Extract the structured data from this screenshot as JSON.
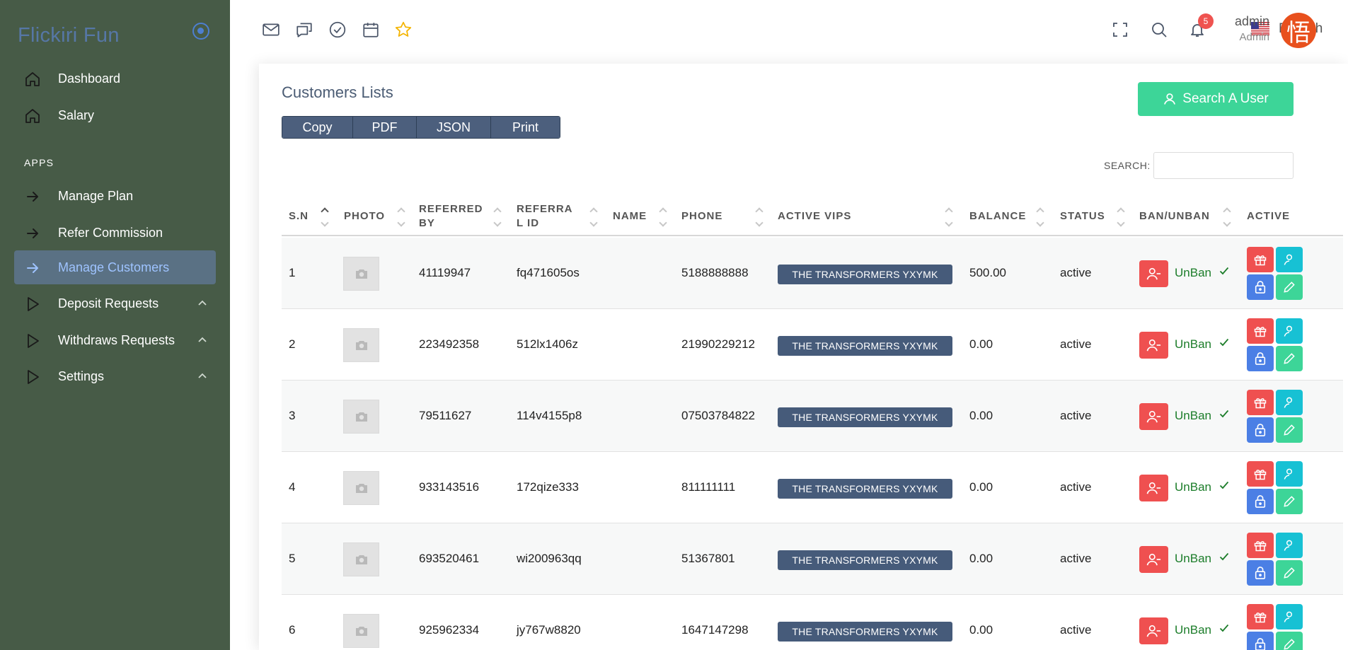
{
  "app": {
    "brand": "Flickiri Fun"
  },
  "sidebar": {
    "items": [
      {
        "label": "Dashboard",
        "icon": "home-icon"
      },
      {
        "label": "Salary",
        "icon": "home-icon"
      }
    ],
    "section_label": "APPS",
    "apps": [
      {
        "label": "Manage Plan",
        "icon": "arrow-right-icon"
      },
      {
        "label": "Refer Commission",
        "icon": "arrow-right-icon"
      },
      {
        "label": "Manage Customers",
        "icon": "arrow-right-icon",
        "active": true
      },
      {
        "label": "Deposit Requests",
        "icon": "play-triangle-icon"
      },
      {
        "label": "Withdraws Requests",
        "icon": "play-triangle-icon"
      },
      {
        "label": "Settings",
        "icon": "play-triangle-icon"
      }
    ]
  },
  "topbar": {
    "language": "English",
    "notifications_count": "5",
    "user_name": "admin",
    "user_role": "Admin",
    "avatar_text": "悟"
  },
  "page": {
    "title": "Customers Lists",
    "export_buttons": [
      "Copy",
      "PDF",
      "JSON",
      "Print"
    ],
    "search_user_label": "Search A User",
    "search_label": "SEARCH:",
    "search_value": ""
  },
  "table": {
    "headers": {
      "sn": "S.N",
      "photo": "PHOTO",
      "referred_by_1": "REFERRED",
      "referred_by_2": "BY",
      "referral_id_1": "REFERRA",
      "referral_id_2": "L ID",
      "name": "NAME",
      "phone": "PHONE",
      "active_vips": "ACTIVE VIPS",
      "balance": "BALANCE",
      "status": "STATUS",
      "ban_unban": "BAN/UNBAN",
      "active": "ACTIVE"
    },
    "rows": [
      {
        "sn": "1",
        "referred_by": "41119947",
        "referral_id": "fq471605os",
        "name": "",
        "phone": "5188888888",
        "vip": "THE TRANSFORMERS YXYMK",
        "balance": "500.00",
        "status": "active",
        "ban": "UnBan"
      },
      {
        "sn": "2",
        "referred_by": "223492358",
        "referral_id": "512lx1406z",
        "name": "",
        "phone": "21990229212",
        "vip": "THE TRANSFORMERS YXYMK",
        "balance": "0.00",
        "status": "active",
        "ban": "UnBan"
      },
      {
        "sn": "3",
        "referred_by": "79511627",
        "referral_id": "114v4155p8",
        "name": "",
        "phone": "07503784822",
        "vip": "THE TRANSFORMERS YXYMK",
        "balance": "0.00",
        "status": "active",
        "ban": "UnBan"
      },
      {
        "sn": "4",
        "referred_by": "933143516",
        "referral_id": "172qize333",
        "name": "",
        "phone": "811111111",
        "vip": "THE TRANSFORMERS YXYMK",
        "balance": "0.00",
        "status": "active",
        "ban": "UnBan"
      },
      {
        "sn": "5",
        "referred_by": "693520461",
        "referral_id": "wi200963qq",
        "name": "",
        "phone": "51367801",
        "vip": "THE TRANSFORMERS YXYMK",
        "balance": "0.00",
        "status": "active",
        "ban": "UnBan"
      },
      {
        "sn": "6",
        "referred_by": "925962334",
        "referral_id": "jy767w8820",
        "name": "",
        "phone": "1647147298",
        "vip": "THE TRANSFORMERS YXYMK",
        "balance": "0.00",
        "status": "active",
        "ban": "UnBan"
      }
    ]
  },
  "colors": {
    "sidebar_bg": "#475b47",
    "accent_blue": "#4d7fd0",
    "button_dark": "#4c5f7d",
    "success_green": "#3dd598",
    "danger_red": "#ef5050"
  }
}
